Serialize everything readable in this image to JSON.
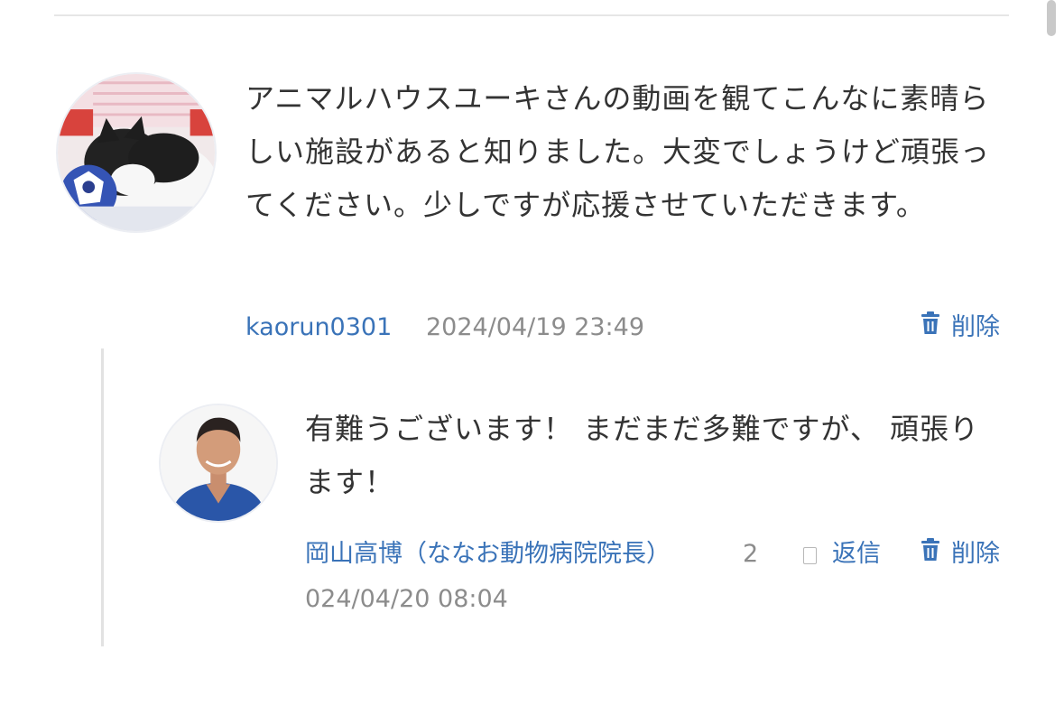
{
  "comment": {
    "text": "アニマルハウスユーキさんの動画を観てこんなに素晴らしい施設があると知りました。大変でしょうけど頑張ってください。少しですが応援させていただきます。",
    "username": "kaorun0301",
    "timestamp": "2024/04/19 23:49",
    "delete_label": "削除",
    "avatar_icon": "cat-avatar"
  },
  "reply": {
    "text": "有難うございます！ まだまだ多難ですが、 頑張ります！",
    "username": "岡山高博（ななお動物病院院長）",
    "count": "2",
    "reply_label": "返信",
    "delete_label": "削除",
    "timestamp": "024/04/20 08:04",
    "avatar_icon": "doctor-avatar"
  },
  "colors": {
    "link": "#3a73b8",
    "text": "#333333",
    "muted": "#8c8c8c",
    "divider": "#e2e2e2"
  }
}
